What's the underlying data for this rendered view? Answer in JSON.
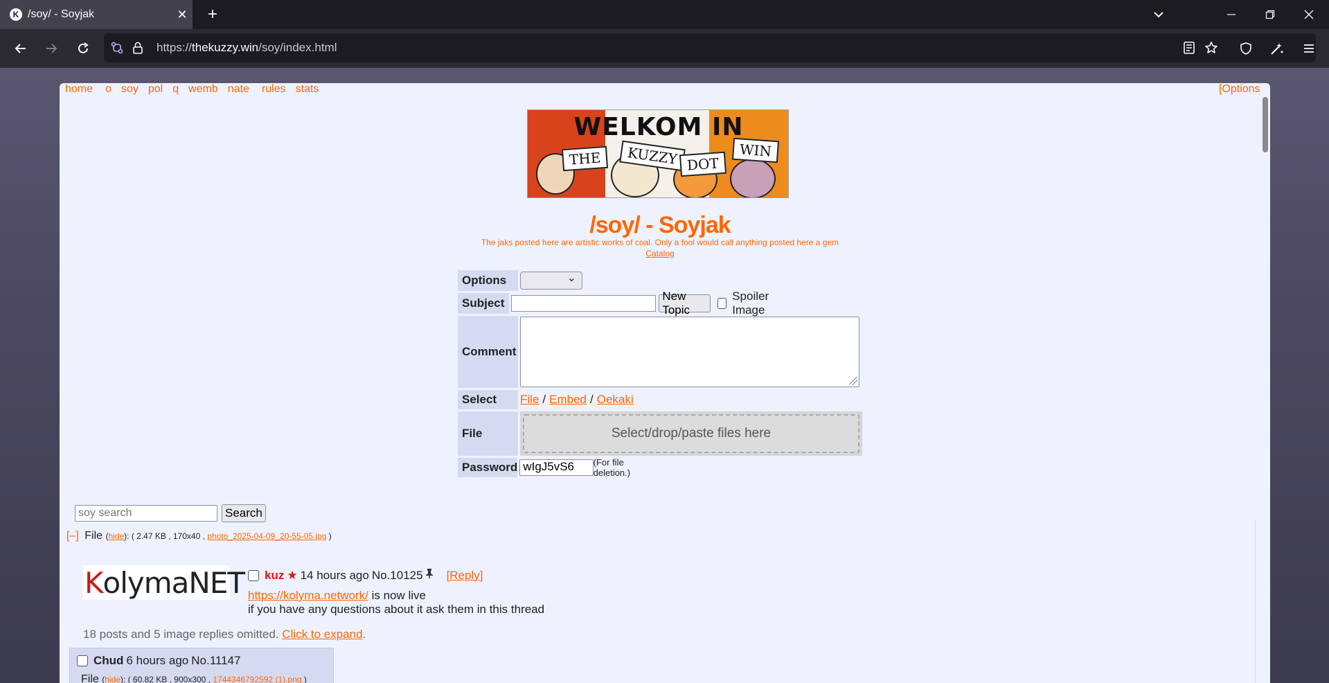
{
  "browser": {
    "tab_title": "/soy/ - Soyjak",
    "favicon_letter": "K",
    "url_scheme": "https://",
    "url_host": "thekuzzy.win",
    "url_path": "/soy/index.html"
  },
  "boardlist": {
    "items": [
      "home",
      "o",
      "soy",
      "pol",
      "q",
      "wemb",
      "nate",
      "rules",
      "stats"
    ],
    "options": "[Options]"
  },
  "banner": {
    "welkom": "WELKOM IN",
    "signs": [
      "THE",
      "KUZZY",
      "DOT",
      "WIN"
    ]
  },
  "header": {
    "title": "/soy/ - Soyjak",
    "subtitle": "The jaks posted here are artistic works of coal. Only a fool would call anything posted here a gem",
    "catalog": "Catalog"
  },
  "form": {
    "options_label": "Options",
    "subject_label": "Subject",
    "new_topic": "New Topic",
    "spoiler": "Spoiler Image",
    "comment_label": "Comment",
    "select_label": "Select",
    "select_file": "File",
    "select_embed": "Embed",
    "select_oekaki": "Oekaki",
    "sep": "/",
    "file_label": "File",
    "dropzone": "Select/drop/paste files here",
    "password_label": "Password",
    "password_value": "wIgJ5vS6",
    "password_note": "(For file deletion.)"
  },
  "search": {
    "placeholder": "soy search",
    "button": "Search"
  },
  "thread": {
    "collapse": "[–]",
    "file_word": "File",
    "hide": "hide",
    "file_meta": "2.47 KB , 170x40 ,",
    "file_name": "photo_2025-04-09_20-55-05.jpg",
    "thumb_text_k": "K",
    "thumb_text_rest": "olymaNET",
    "author": "kuz",
    "star": "★",
    "time": "14 hours ago",
    "post_no": "No.10125",
    "pin": "📌",
    "reply": "[Reply]",
    "body_link": "https://kolyma.network/",
    "body_text1": "is now live",
    "body_text2": "if you have any questions about it ask them in this thread",
    "omitted_text": "18 posts and 5 image replies omitted.",
    "expand": "Click to expand",
    "period": "."
  },
  "reply": {
    "author": "Chud",
    "time": "6 hours ago",
    "post_no": "No.11147",
    "file_word": "File",
    "hide": "hide",
    "file_meta": "60.82 KB , 900x300 ,",
    "file_name": "1744346792592 (1).png"
  }
}
